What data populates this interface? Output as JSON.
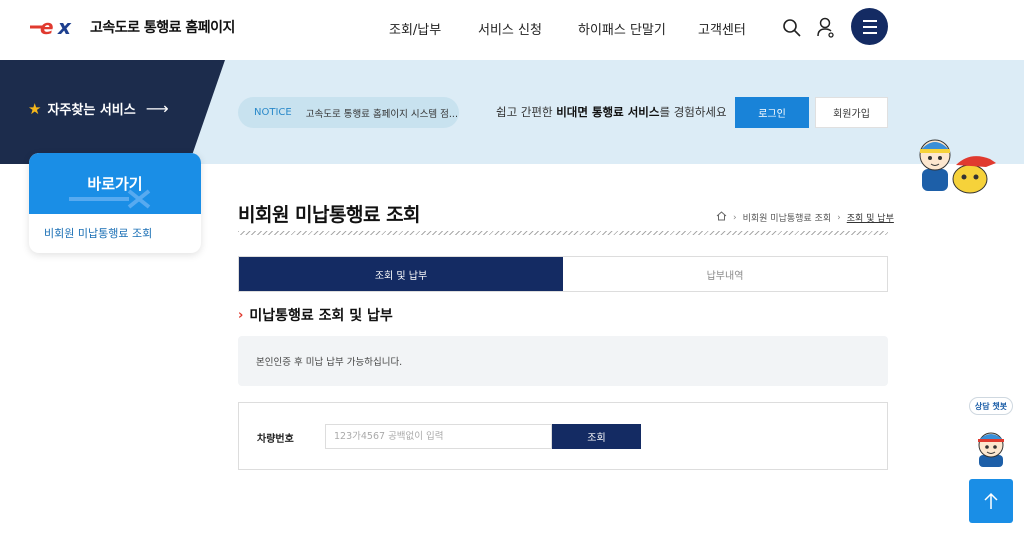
{
  "header": {
    "site_title": "고속도로 통행료 홈페이지",
    "nav": [
      "조회/납부",
      "서비스 신청",
      "하이패스 단말기",
      "고객센터"
    ]
  },
  "banner": {
    "frequent_services": "자주찾는 서비스",
    "notice_label": "NOTICE",
    "notice_text": "고속도로 통행료 홈페이지 시스템 점...",
    "promo_pre": "쉽고 간편한 ",
    "promo_bold": "비대면 통행료 서비스",
    "promo_post": "를 경험하세요",
    "login": "로그인",
    "join": "회원가입"
  },
  "sidebar": {
    "title": "바로가기",
    "items": [
      "비회원 미납통행료 조회"
    ]
  },
  "main": {
    "page_title": "비회원 미납통행료 조회",
    "breadcrumb": [
      "비회원 미납통행료 조회",
      "조회 및 납부"
    ],
    "tabs": [
      {
        "label": "조회 및 납부",
        "active": true
      },
      {
        "label": "납부내역",
        "active": false
      }
    ],
    "section_title": "미납통행료 조회 및 납부",
    "info_text": "본인인증 후 미납 납부 가능하십니다.",
    "form": {
      "label": "차량번호",
      "placeholder": "123가4567 공백없이 입력",
      "value": "",
      "submit": "조회"
    }
  },
  "floating": {
    "chatbot": "상담 챗봇"
  },
  "colors": {
    "navy": "#142b63",
    "blue": "#1a8ee6",
    "banner_dark": "#1c2c4c",
    "banner_light": "#dcecf6",
    "accent_red": "#e03a2f"
  },
  "icons": [
    "search-icon",
    "user-icon",
    "menu-icon",
    "star-icon",
    "arrow-right-icon",
    "home-icon",
    "arrow-up-icon"
  ]
}
